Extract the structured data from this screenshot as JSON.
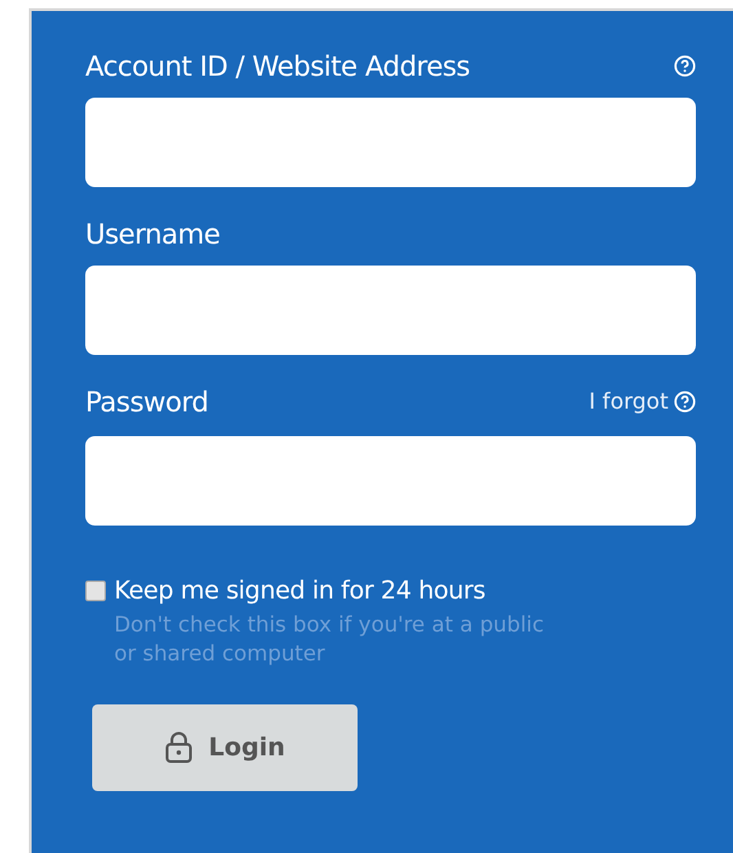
{
  "fields": [
    {
      "label": "Account ID / Website Address",
      "kind": "help"
    },
    {
      "label": "Username",
      "kind": "plain"
    },
    {
      "label": "Password",
      "kind": "forgot",
      "link": "I forgot"
    }
  ],
  "remember": {
    "label": "Keep me signed in for 24 hours",
    "checked": false,
    "hint": "Don't check this box if you're at a public or shared computer"
  },
  "login_button": {
    "label": "Login",
    "disabled": true
  }
}
